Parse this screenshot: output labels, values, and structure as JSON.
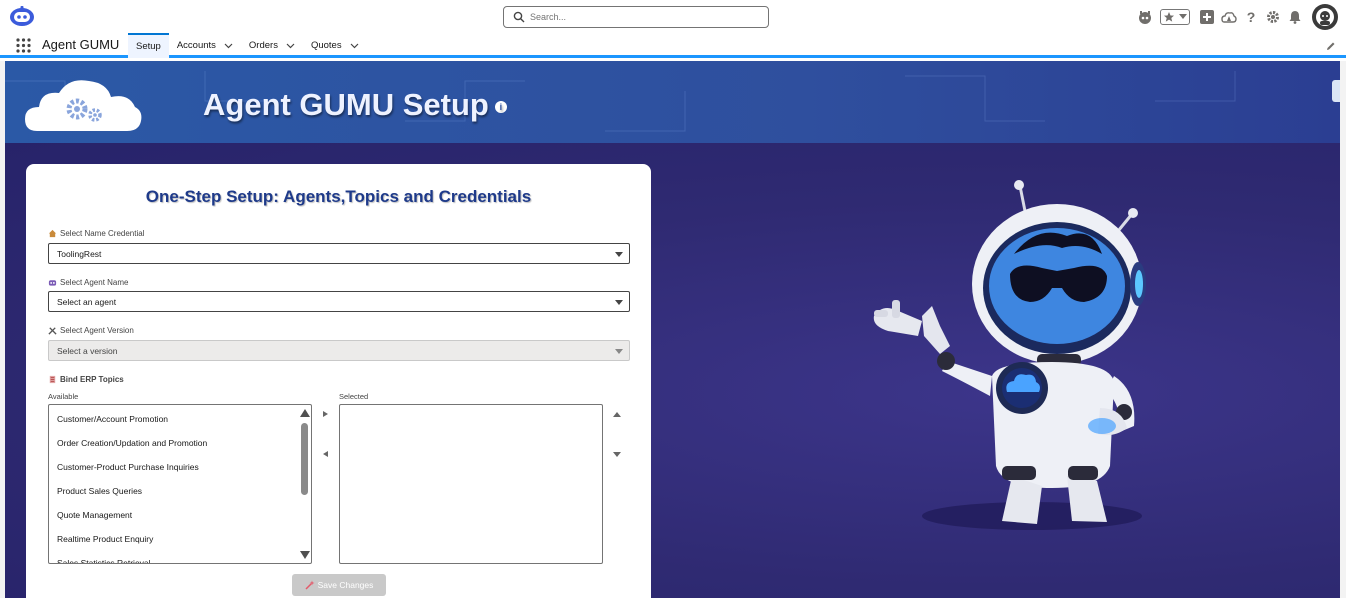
{
  "header": {
    "search_placeholder": "Search...",
    "icons": [
      "agent-face-icon",
      "favorites-star-icon",
      "favorites-dropdown-icon",
      "add-icon",
      "trailhead-icon",
      "help-icon",
      "setup-gear-icon",
      "notifications-bell-icon",
      "user-avatar-icon"
    ]
  },
  "nav": {
    "app_name": "Agent GUMU",
    "tabs": [
      {
        "label": "Setup",
        "active": true
      },
      {
        "label": "Accounts"
      },
      {
        "label": "Orders"
      },
      {
        "label": "Quotes"
      }
    ]
  },
  "banner": {
    "title": "Agent GUMU Setup",
    "info_glyph": "i"
  },
  "form": {
    "title": "One-Step Setup: Agents,Topics and Credentials",
    "credential": {
      "label": "Select Name Credential",
      "value": "ToolingRest"
    },
    "agent": {
      "label": "Select Agent Name",
      "value": "Select an agent"
    },
    "version": {
      "label": "Select Agent Version",
      "value": "Select a version"
    },
    "topics": {
      "label": "Bind ERP Topics",
      "available_label": "Available",
      "selected_label": "Selected",
      "available": [
        "Customer/Account Promotion",
        "Order Creation/Updation and Promotion",
        "Customer-Product Purchase Inquiries",
        "Product Sales Queries",
        "Quote Management",
        "Realtime Product Enquiry",
        "Sales Statistics Retrieval"
      ],
      "selected": []
    },
    "save_label": "Save Changes"
  },
  "colors": {
    "brand_blue": "#0176d3",
    "banner": "#2f4f9e",
    "panel": "#2f2a72",
    "title_blue": "#1e3a8a"
  }
}
